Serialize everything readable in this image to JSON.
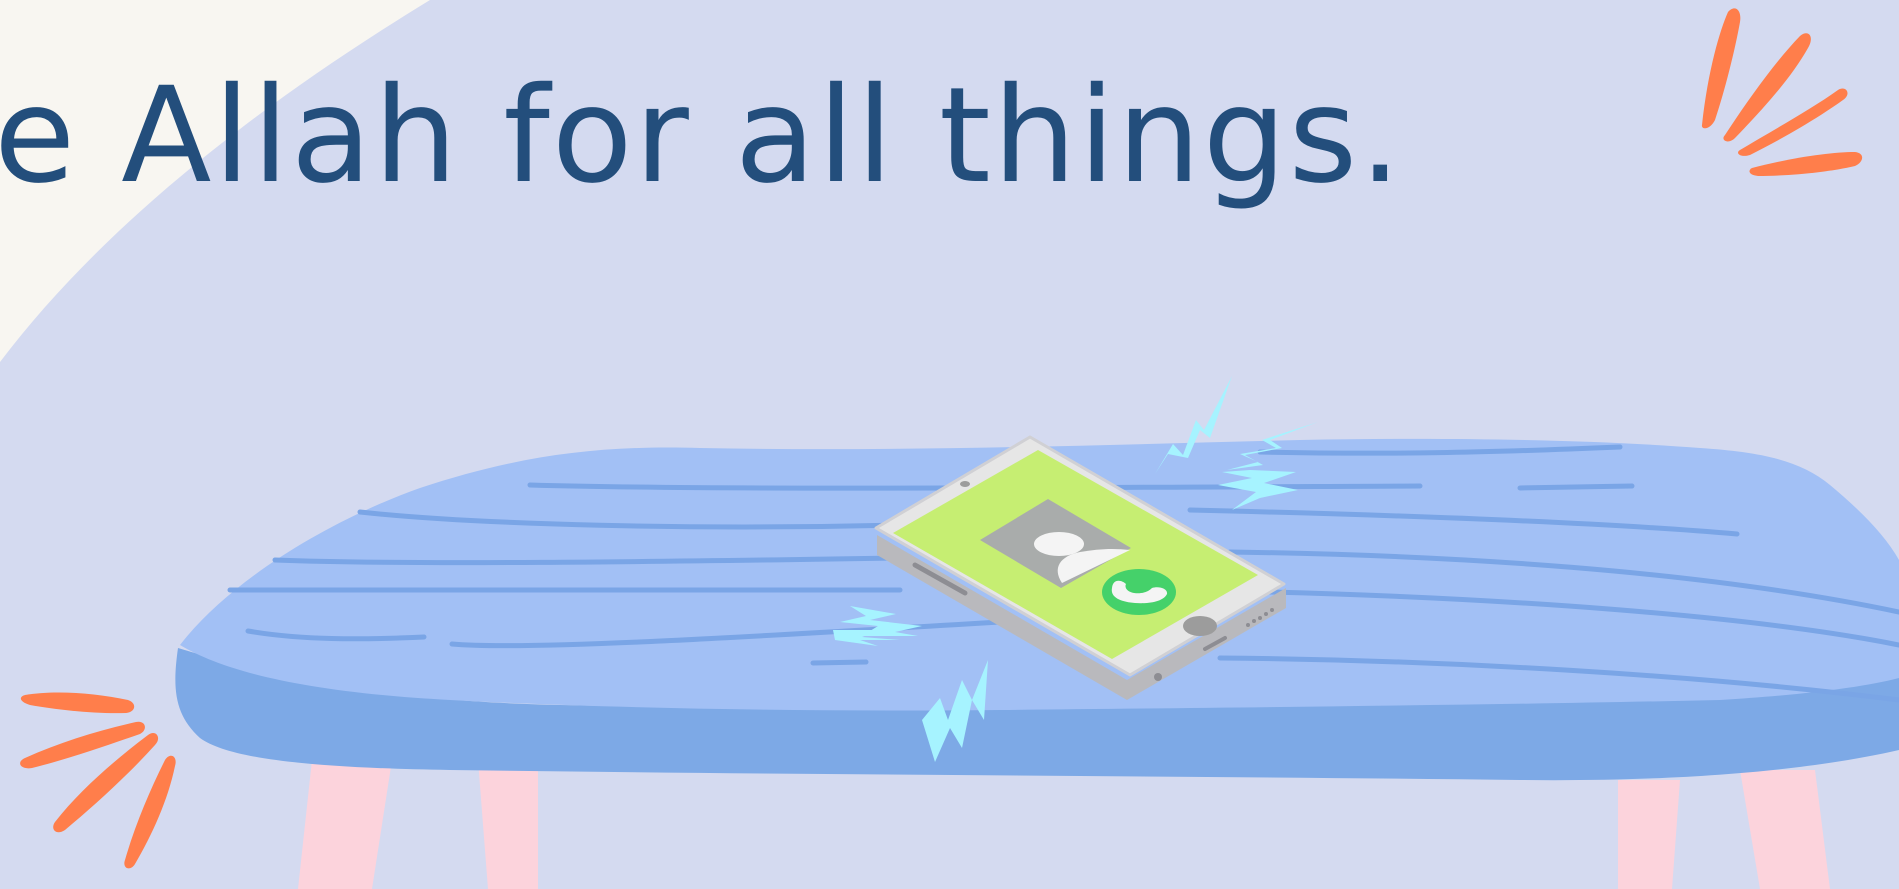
{
  "headline": "e Allah for all things.",
  "colors": {
    "background": "#d4daf0",
    "corner_cream": "#f8f6f1",
    "headline_text": "#234e7c",
    "table_top": "#a2c0f5",
    "table_edge": "#7da9e6",
    "table_grain": "#7aa5e6",
    "table_legs": "#fcd3dc",
    "accent_strokes": "#ff7e4b",
    "phone_body": "#e6e6e6",
    "phone_screen": "#c6ee72",
    "call_button": "#45d16a",
    "vibration_bolts": "#a6f3ff"
  },
  "icons": [
    "phone-icon",
    "call-handset-icon",
    "caller-avatar-icon",
    "vibration-bolt-icon",
    "accent-strokes-icon"
  ]
}
